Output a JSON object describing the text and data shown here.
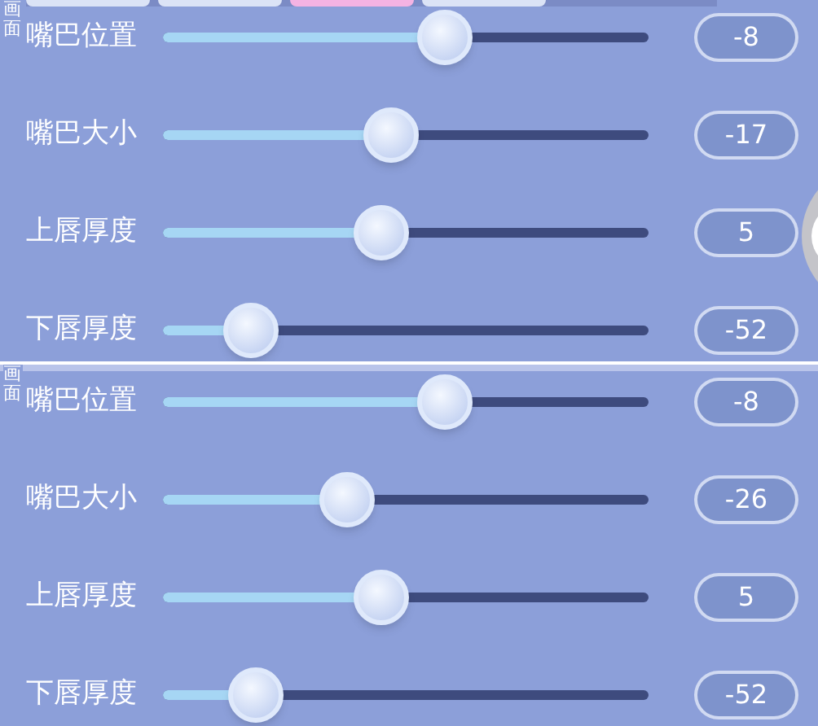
{
  "panels": [
    {
      "side_tab": "画面",
      "tabs": [
        {
          "selected": false
        },
        {
          "selected": false
        },
        {
          "selected": true
        },
        {
          "selected": false
        }
      ],
      "floating_button": true,
      "sliders": [
        {
          "name": "嘴巴位置",
          "level": 0.58,
          "reading": "-8"
        },
        {
          "name": "嘴巴大小",
          "level": 0.47,
          "reading": "-17"
        },
        {
          "name": "上唇厚度",
          "level": 0.45,
          "reading": "5"
        },
        {
          "name": "下唇厚度",
          "level": 0.18,
          "reading": "-52"
        }
      ]
    },
    {
      "side_tab": "画面",
      "floating_button": false,
      "sliders": [
        {
          "name": "嘴巴位置",
          "level": 0.58,
          "reading": "-8"
        },
        {
          "name": "嘴巴大小",
          "level": 0.38,
          "reading": "-26"
        },
        {
          "name": "上唇厚度",
          "level": 0.45,
          "reading": "5"
        },
        {
          "name": "下唇厚度",
          "level": 0.19,
          "reading": "-52"
        }
      ]
    }
  ]
}
